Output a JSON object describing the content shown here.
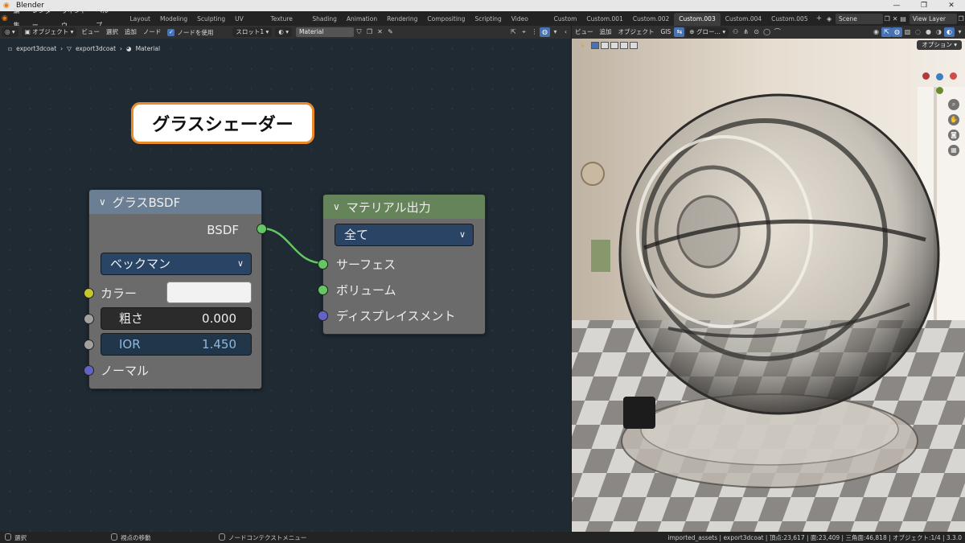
{
  "window": {
    "title": "Blender",
    "controls": [
      "—",
      "❐",
      "✕"
    ]
  },
  "menubar": {
    "items": [
      "編集",
      "レンダー",
      "ウィンドウ",
      "ヘルプ"
    ],
    "workspace_tabs": [
      "Layout",
      "Modeling",
      "Sculpting",
      "UV Editing",
      "Texture Paint",
      "Shading",
      "Animation",
      "Rendering",
      "Compositing",
      "Scripting",
      "Video Editing",
      "Custom",
      "Custom.001",
      "Custom.002",
      "Custom.003",
      "Custom.004",
      "Custom.005"
    ],
    "active_tab": "Custom.003",
    "scene": "Scene",
    "view_layer": "View Layer"
  },
  "node_header": {
    "object_mode": "オブジェクト",
    "menus": [
      "ビュー",
      "選択",
      "追加",
      "ノード"
    ],
    "use_nodes_label": "ノードを使用",
    "use_nodes_checked": true,
    "slot": "スロット1",
    "material": "Material"
  },
  "viewport_header": {
    "menus": [
      "ビュー",
      "追加",
      "オブジェクト",
      "GIS"
    ],
    "transform_orientation": "グロー…",
    "options_label": "オプション"
  },
  "breadcrumb": [
    "export3dcoat",
    "export3dcoat",
    "Material"
  ],
  "callout": {
    "text": "グラスシェーダー"
  },
  "glass_node": {
    "title": "グラスBSDF",
    "output_label": "BSDF",
    "distribution": "ベックマン",
    "color_label": "カラー",
    "color_value": "#f2f2f2",
    "roughness_label": "粗さ",
    "roughness_value": "0.000",
    "ior_label": "IOR",
    "ior_value": "1.450",
    "normal_label": "ノーマル"
  },
  "output_node": {
    "title": "マテリアル出力",
    "target": "全て",
    "inputs": [
      "サーフェス",
      "ボリューム",
      "ディスプレイスメント"
    ]
  },
  "statusbar": {
    "select": "選択",
    "pan": "視点の移動",
    "context_menu": "ノードコンテクストメニュー",
    "stats": "imported_assets | export3dcoat | 頂点:23,617 | 面:23,409 | 三角面:46,818 | オブジェクト:1/4 | 3.3.0"
  },
  "colors": {
    "accent": "#4772b3",
    "callout_border": "#e88c2a",
    "glass_header": "#6a7f94",
    "output_header": "#65845a",
    "socket_shader": "#63c763",
    "socket_color": "#c7c729",
    "socket_float": "#a1a1a1",
    "socket_vector": "#6363c7"
  }
}
